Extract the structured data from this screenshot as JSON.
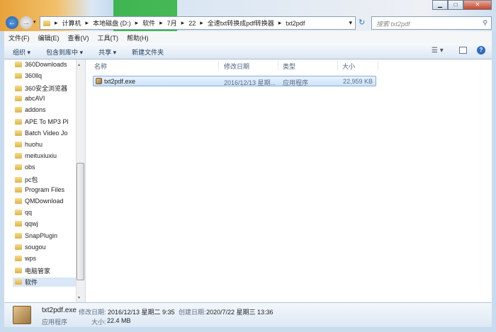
{
  "address": {
    "crumbs": [
      "计算机",
      "本地磁盘 (D:)",
      "软件",
      "7月",
      "22",
      "全速txt转换成pdf转换器",
      "txt2pdf"
    ]
  },
  "search": {
    "placeholder": "搜索 txt2pdf"
  },
  "menu": [
    "文件(F)",
    "编辑(E)",
    "查看(V)",
    "工具(T)",
    "帮助(H)"
  ],
  "toolbar": [
    "组织 ▾",
    "包含到库中 ▾",
    "共享 ▾",
    "新建文件夹"
  ],
  "sidebar": [
    "360Downloads",
    "360llq",
    "360安全浏览器",
    "abcAVI",
    "addons",
    "APE To MP3 Pl",
    "Batch Video Jo",
    "huohu",
    "meituxiuxiu",
    "obs",
    "pc包",
    "Program Files",
    "QMDownload",
    "qq",
    "qqwj",
    "SnapPlugin",
    "sougou",
    "wps",
    "电脑管家",
    "软件"
  ],
  "columns": [
    "名称",
    "修改日期",
    "类型",
    "大小"
  ],
  "files": [
    {
      "name": "txt2pdf.exe",
      "modified": "2016/12/13 星期...",
      "type": "应用程序",
      "size": "22,959 KB"
    }
  ],
  "status": {
    "name": "txt2pdf.exe",
    "modified_label": "修改日期:",
    "modified": "2016/12/13 星期二 9:35",
    "created_label": "创建日期:",
    "created": "2020/7/22 星期三 13:36",
    "type": "应用程序",
    "size_label": "大小:",
    "size": "22.4 MB"
  }
}
